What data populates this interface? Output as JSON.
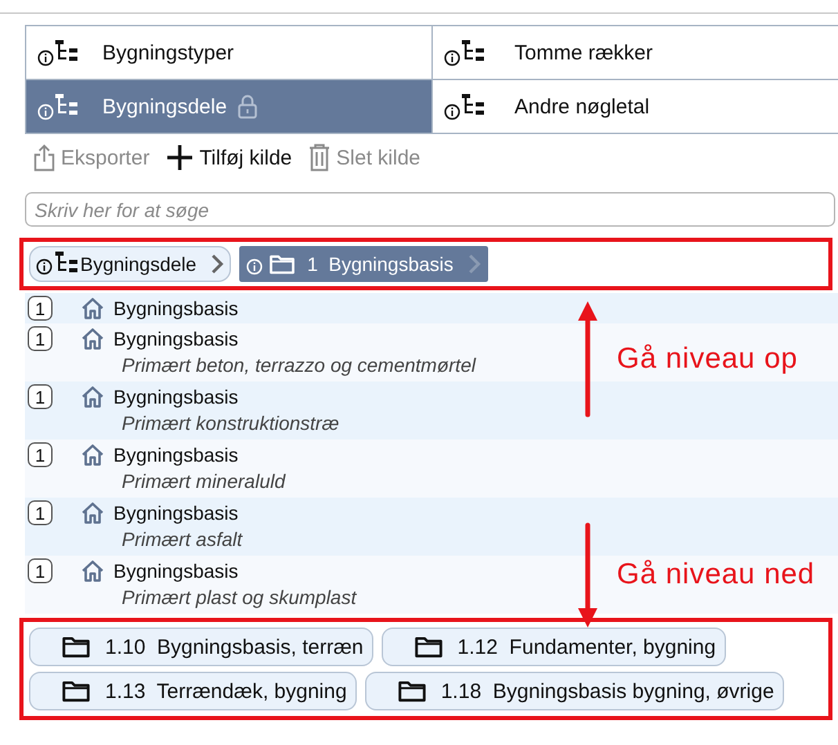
{
  "tabs": [
    {
      "label": "Bygningstyper",
      "selected": false,
      "locked": false
    },
    {
      "label": "Tomme rækker",
      "selected": false,
      "locked": false
    },
    {
      "label": "Bygningsdele",
      "selected": true,
      "locked": true
    },
    {
      "label": "Andre nøgletal",
      "selected": false,
      "locked": false
    }
  ],
  "toolbar": [
    {
      "kind": "export",
      "label": "Eksporter",
      "disabled": true
    },
    {
      "kind": "add",
      "label": "Tilføj kilde",
      "disabled": false
    },
    {
      "kind": "delete",
      "label": "Slet kilde",
      "disabled": true
    }
  ],
  "search": {
    "placeholder": "Skriv her for at søge"
  },
  "breadcrumb": [
    {
      "kind": "tree",
      "label": "Bygningsdele",
      "selected": false
    },
    {
      "kind": "folder",
      "label": "1  Bygningsbasis",
      "selected": true
    }
  ],
  "items": [
    {
      "badge": "1",
      "title": "Bygningsbasis"
    },
    {
      "badge": "1",
      "title": "Bygningsbasis",
      "subtitle": "Primært beton, terrazzo og cementmørtel"
    },
    {
      "badge": "1",
      "title": "Bygningsbasis",
      "subtitle": "Primært konstruktionstræ"
    },
    {
      "badge": "1",
      "title": "Bygningsbasis",
      "subtitle": "Primært mineraluld"
    },
    {
      "badge": "1",
      "title": "Bygningsbasis",
      "subtitle": "Primært asfalt"
    },
    {
      "badge": "1",
      "title": "Bygningsbasis",
      "subtitle": "Primært plast og skumplast"
    }
  ],
  "annotations": [
    {
      "kind": "up",
      "text": "Gå niveau op"
    },
    {
      "kind": "down",
      "text": "Gå niveau ned"
    }
  ],
  "subfolders": [
    {
      "label": "1.10  Bygningsbasis, terræn"
    },
    {
      "label": "1.12  Fundamenter, bygning"
    },
    {
      "label": "1.13  Terrændæk, bygning"
    },
    {
      "label": "1.18  Bygningsbasis bygning, øvrige"
    }
  ]
}
